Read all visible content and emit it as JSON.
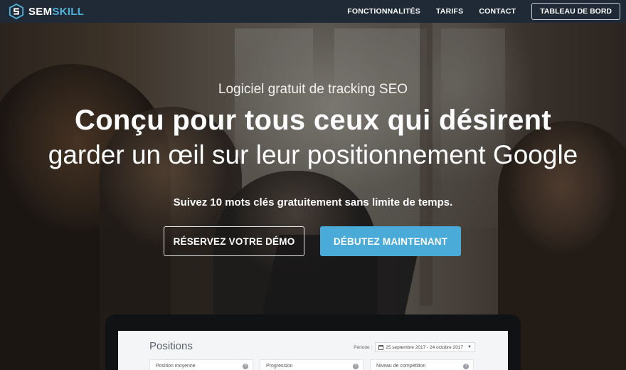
{
  "brand": {
    "part1": "SEM",
    "part2": "SKILL",
    "accent": "#4fb0d8"
  },
  "nav": {
    "links": [
      "FONCTIONNALITÉS",
      "TARIFS",
      "CONTACT"
    ],
    "dashboard_button": "TABLEAU DE BORD"
  },
  "hero": {
    "subtitle": "Logiciel gratuit de tracking SEO",
    "headline": "Conçu pour tous ceux qui désirent",
    "headline2": "garder un œil sur leur positionnement Google",
    "tagline": "Suivez 10 mots clés gratuitement sans limite de temps.",
    "button_demo": "RÉSERVEZ VOTRE DÉMO",
    "button_start": "DÉBUTEZ MAINTENANT",
    "button_start_color": "#4aaad8"
  },
  "dashboard": {
    "title": "Positions",
    "period_label": "Période :",
    "period_value": "25 septembre 2017 - 24 octobre 2017",
    "cards": [
      "Position moyenne",
      "Progression",
      "Niveau de compétition"
    ]
  },
  "icons": {
    "logo": "semskill-logo-icon",
    "calendar": "calendar-icon",
    "dropdown": "chevron-down-icon",
    "help": "help-icon"
  }
}
